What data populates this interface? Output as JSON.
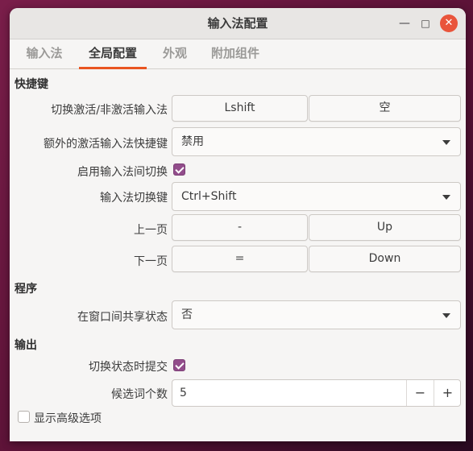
{
  "window": {
    "title": "输入法配置",
    "minimize_glyph": "—",
    "maximize_glyph": "□",
    "close_glyph": "✕"
  },
  "tabs": [
    {
      "label": "输入法",
      "active": false
    },
    {
      "label": "全局配置",
      "active": true
    },
    {
      "label": "外观",
      "active": false
    },
    {
      "label": "附加组件",
      "active": false
    }
  ],
  "hotkeys": {
    "section": "快捷键",
    "toggle_label": "切换激活/非激活输入法",
    "toggle_key1": "Lshift",
    "toggle_key2": "空",
    "extra_label": "额外的激活输入法快捷键",
    "extra_value": "禁用",
    "enable_switch_label": "启用输入法间切换",
    "enable_switch_checked": true,
    "switch_key_label": "输入法切换键",
    "switch_key_value": "Ctrl+Shift",
    "prev_page_label": "上一页",
    "prev_page_key1": "-",
    "prev_page_key2": "Up",
    "next_page_label": "下一页",
    "next_page_key1": "=",
    "next_page_key2": "Down"
  },
  "program": {
    "section": "程序",
    "share_state_label": "在窗口间共享状态",
    "share_state_value": "否"
  },
  "output": {
    "section": "输出",
    "commit_label": "切换状态时提交",
    "commit_checked": true,
    "candidates_label": "候选词个数",
    "candidates_value": "5",
    "minus_glyph": "−",
    "plus_glyph": "+"
  },
  "advanced": {
    "label": "显示高级选项",
    "checked": false
  },
  "colors": {
    "accent": "#e95420",
    "checkbox": "#924d8b",
    "close_button": "#e9543b"
  }
}
